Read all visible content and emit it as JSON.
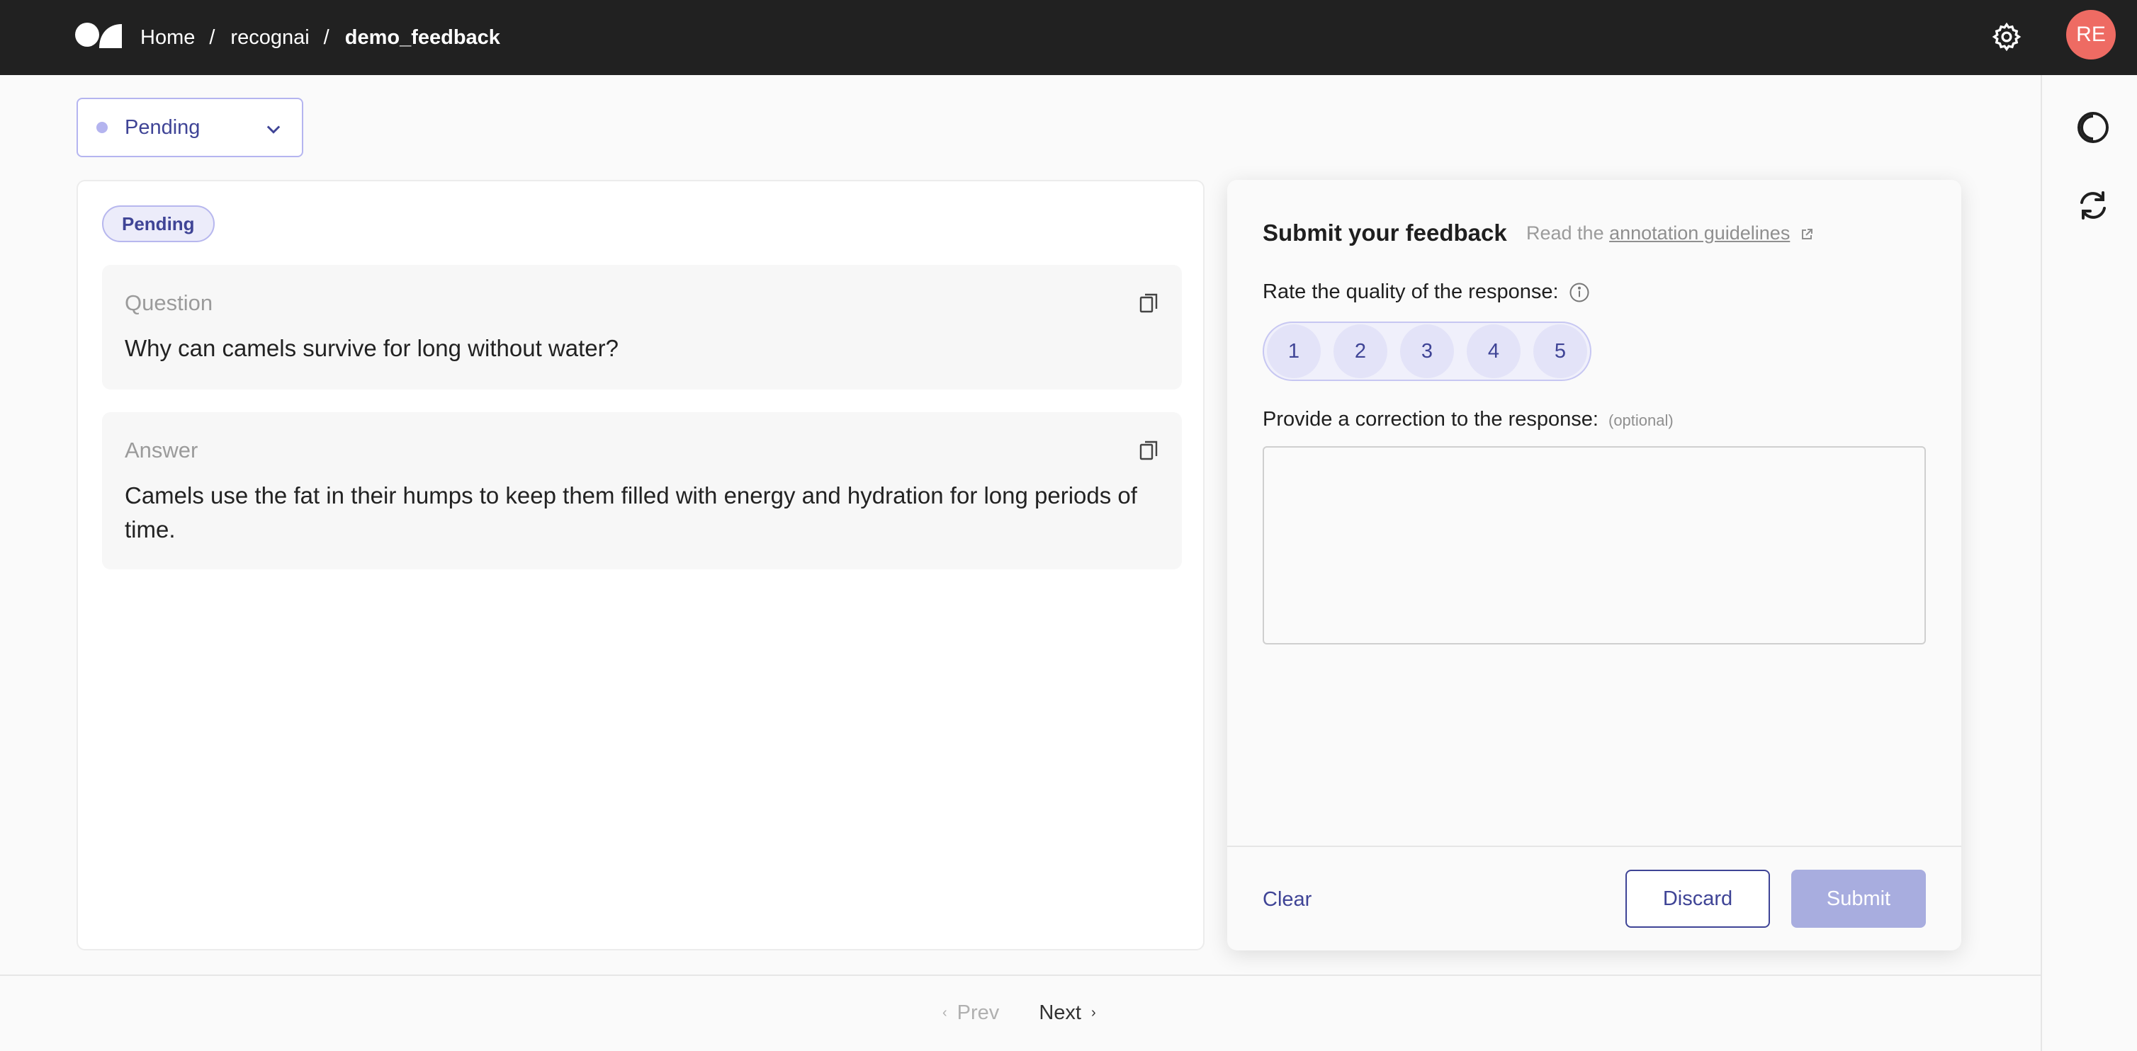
{
  "header": {
    "breadcrumbs": [
      "Home",
      "recognai",
      "demo_feedback"
    ],
    "separator": "/",
    "avatar_initials": "RE"
  },
  "status_filter": {
    "selected": "Pending"
  },
  "record": {
    "status_badge": "Pending",
    "fields": [
      {
        "title": "Question",
        "content": "Why can camels survive for long without water?"
      },
      {
        "title": "Answer",
        "content": "Camels use the fat in their humps to keep them filled with energy and hydration for long periods of time."
      }
    ]
  },
  "feedback": {
    "title": "Submit your feedback",
    "guidelines_prefix": "Read the",
    "guidelines_link": "annotation guidelines",
    "rating_question": "Rate the quality of the response:",
    "rating_options": [
      "1",
      "2",
      "3",
      "4",
      "5"
    ],
    "correction_question": "Provide a correction to the response:",
    "correction_optional": "(optional)",
    "correction_value": "",
    "clear_label": "Clear",
    "discard_label": "Discard",
    "submit_label": "Submit"
  },
  "pagination": {
    "prev_label": "Prev",
    "next_label": "Next"
  },
  "colors": {
    "topbar": "#212121",
    "accent": "#3f4496",
    "avatar": "#ee6b63",
    "submit_disabled": "#a8addf"
  },
  "icons": {
    "logo": "argilla-logo",
    "settings": "gear-icon",
    "theme": "theme-toggle-icon",
    "refresh": "refresh-icon",
    "copy": "copy-icon",
    "info": "info-icon",
    "external": "external-link-icon",
    "dropdown": "chevron-down-icon"
  }
}
